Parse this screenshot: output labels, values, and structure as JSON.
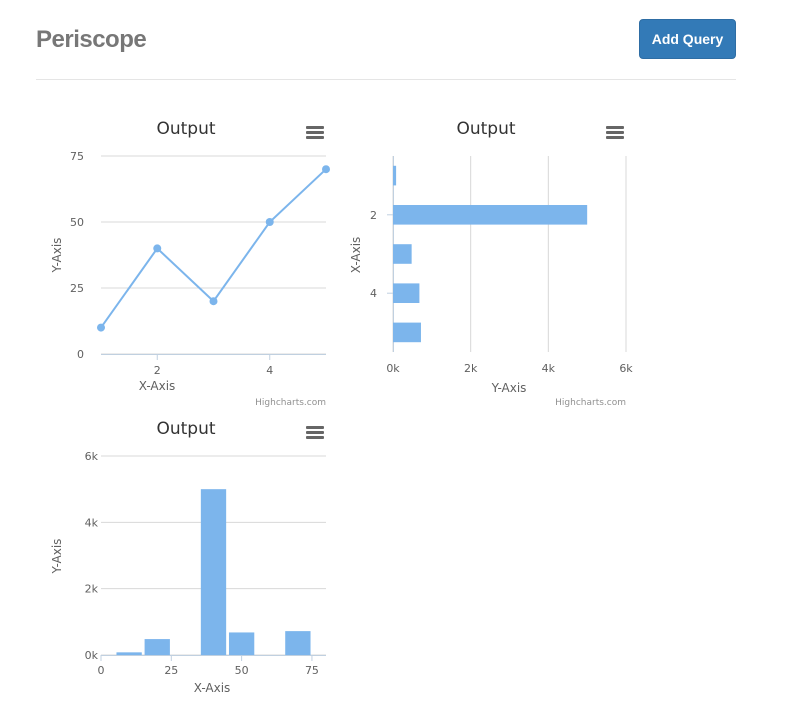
{
  "app": {
    "brand": "Periscope",
    "add_query_label": "Add Query"
  },
  "credits": "Highcharts.com",
  "chart_data": [
    {
      "type": "line",
      "title": "Output",
      "xlabel": "X-Axis",
      "ylabel": "Y-Axis",
      "x": [
        1,
        2,
        3,
        4,
        5
      ],
      "y": [
        10,
        40,
        20,
        50,
        70
      ],
      "xlim": [
        1,
        5
      ],
      "ylim": [
        0,
        75
      ],
      "x_ticks": [
        2,
        4
      ],
      "y_ticks": [
        0,
        25,
        50,
        75
      ],
      "color": "#7cb5ec",
      "grid": true
    },
    {
      "type": "bar",
      "orientation": "horizontal",
      "title": "Output",
      "xlabel": "X-Axis",
      "ylabel": "Y-Axis",
      "categories": [
        1,
        2,
        3,
        4,
        5
      ],
      "values": [
        80,
        5000,
        480,
        680,
        720
      ],
      "category_ticks": [
        2,
        4
      ],
      "value_ticks": [
        "0k",
        "2k",
        "4k",
        "6k"
      ],
      "vlim": [
        0,
        6000
      ],
      "color": "#7cb5ec",
      "grid": true
    },
    {
      "type": "bar",
      "title": "Output",
      "xlabel": "X-Axis",
      "ylabel": "Y-Axis",
      "x": [
        10,
        20,
        40,
        50,
        70
      ],
      "values": [
        80,
        480,
        5000,
        680,
        720
      ],
      "xlim": [
        0,
        80
      ],
      "x_ticks": [
        0,
        25,
        50,
        75
      ],
      "y_ticks": [
        "0k",
        "2k",
        "4k",
        "6k"
      ],
      "ylim": [
        0,
        6000
      ],
      "color": "#7cb5ec",
      "grid": true
    }
  ]
}
